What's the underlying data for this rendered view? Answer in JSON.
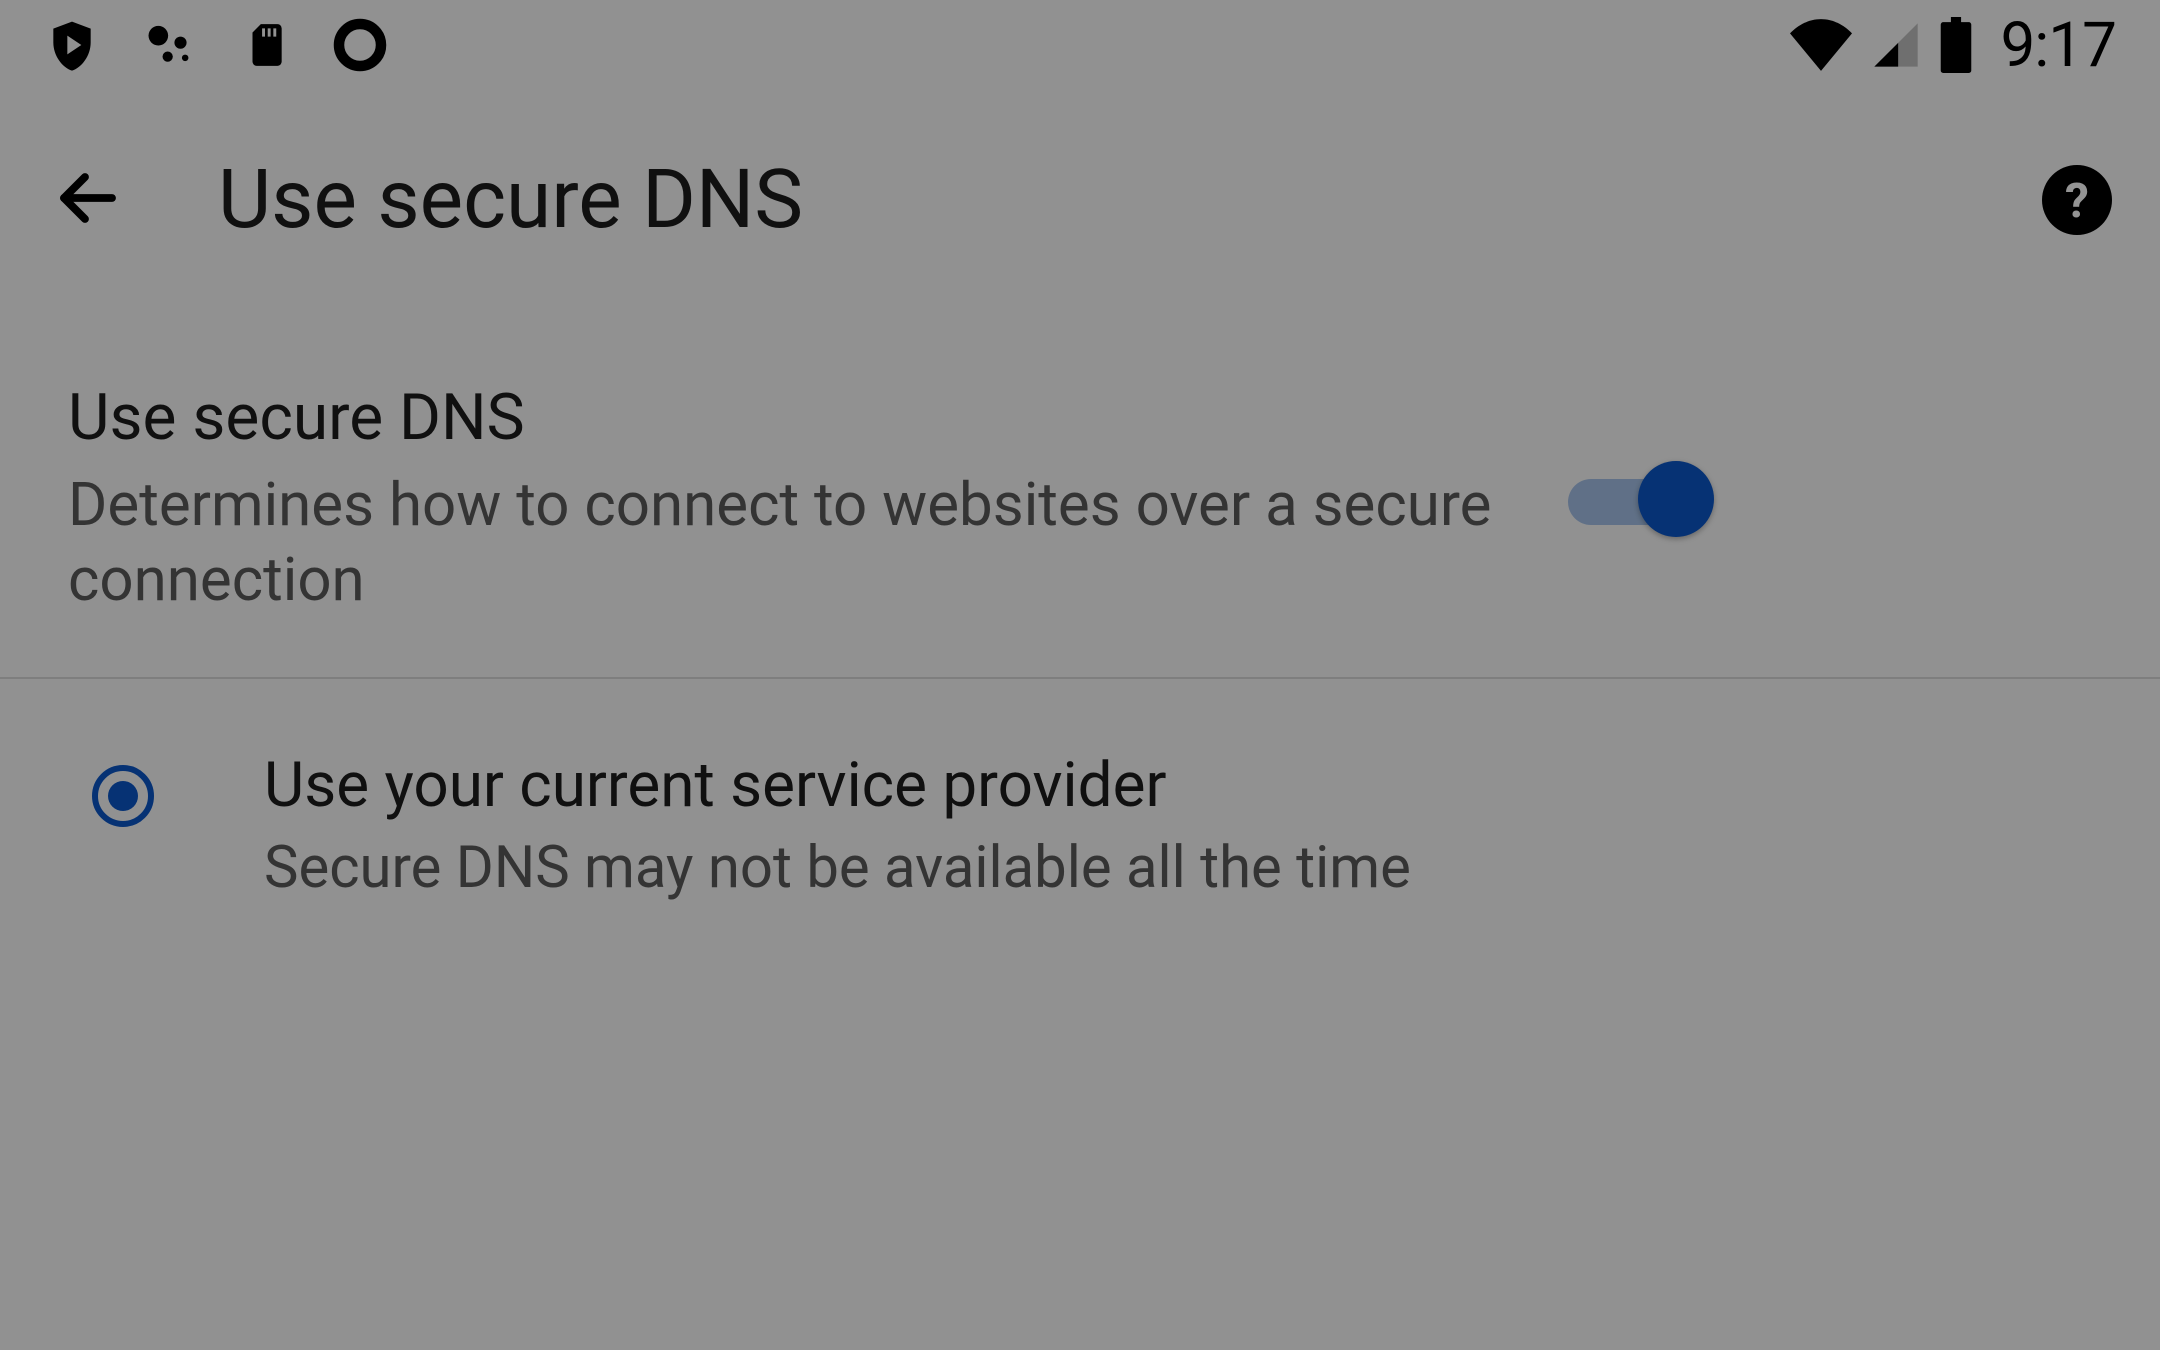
{
  "status_bar": {
    "time": "9:17"
  },
  "appbar": {
    "title": "Use secure DNS"
  },
  "setting": {
    "title": "Use secure DNS",
    "description": "Determines how to connect to websites over a secure connection",
    "enabled": true
  },
  "option": {
    "title": "Use your current service provider",
    "description": "Secure DNS may not be available all the time",
    "selected": true
  },
  "colors": {
    "accent": "#0b57c8"
  }
}
